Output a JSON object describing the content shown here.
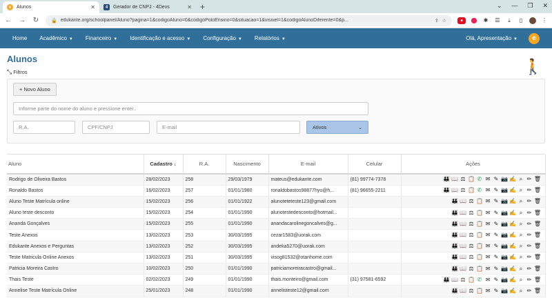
{
  "browser": {
    "tabs": [
      {
        "title": "Alunos",
        "favicon": "e",
        "active": true
      },
      {
        "title": "Gerador de CNPJ - 4Devs",
        "favicon": "4",
        "active": false
      }
    ],
    "url": "edukante.org/schoolpanel/Aluno?pagina=1&codigoAluno=0&codigoPoloEnsino=0&situacao=1&visivel=1&codigoAlunoDiferente=0&p..."
  },
  "nav": {
    "items": [
      {
        "label": "Home",
        "caret": false
      },
      {
        "label": "Acadêmico",
        "caret": true
      },
      {
        "label": "Financeiro",
        "caret": true
      },
      {
        "label": "Identificação e acesso",
        "caret": true
      },
      {
        "label": "Configuração",
        "caret": true
      },
      {
        "label": "Relatórios",
        "caret": true
      }
    ],
    "user": "Olá, Apresentação"
  },
  "page": {
    "title": "Alunos",
    "filters_label": "Filtros"
  },
  "filters": {
    "new_button": "+ Novo Aluno",
    "search_placeholder": "Informe parte do nome do aluno e pressione enter..",
    "ra_placeholder": "R.A.",
    "cpf_placeholder": "CPF/CNPJ",
    "email_placeholder": "E-mail",
    "status_selected": "Ativos"
  },
  "table": {
    "headers": [
      "Aluno",
      "Cadastro",
      "R.A.",
      "Nascimento",
      "E-mail",
      "Celular",
      "Ações"
    ],
    "rows": [
      {
        "aluno": "Rodrigo de Oliveira Bastos",
        "cadastro": "28/02/2023",
        "ra": "258",
        "nascimento": "29/03/1979",
        "email": "mateus@edukante.com",
        "celular": "(81) 99774-7378",
        "whatsapp": true
      },
      {
        "aluno": "Ronaldo Bastos",
        "cadastro": "16/02/2023",
        "ra": "257",
        "nascimento": "01/01/1980",
        "email": "ronaldobastos98877hyu@h...",
        "celular": "(81) 96655-2211",
        "whatsapp": true
      },
      {
        "aluno": "Aluno Teste Matrícula online",
        "cadastro": "15/02/2023",
        "ra": "256",
        "nascimento": "01/01/1922",
        "email": "alunoteteteste123@gmail.com",
        "celular": "",
        "whatsapp": false
      },
      {
        "aluno": "Aluno teste desconto",
        "cadastro": "15/02/2023",
        "ra": "254",
        "nascimento": "01/01/1990",
        "email": "alunotestedesconto@hotmail...",
        "celular": "",
        "whatsapp": false
      },
      {
        "aluno": "Ananda Gonçalves",
        "cadastro": "15/02/2023",
        "ra": "255",
        "nascimento": "01/01/1990",
        "email": "anandacarolinegoncalves@g...",
        "celular": "",
        "whatsapp": false
      },
      {
        "aluno": "Teste Anexos",
        "cadastro": "13/02/2023",
        "ra": "253",
        "nascimento": "30/03/1995",
        "email": "cezar1583@uorak.com",
        "celular": "",
        "whatsapp": false
      },
      {
        "aluno": "Edukante Anexos e Perguntas",
        "cadastro": "13/02/2023",
        "ra": "252",
        "nascimento": "30/03/1995",
        "email": "andeka5270@uorak.com",
        "celular": "",
        "whatsapp": false
      },
      {
        "aluno": "Teste Matricula Online Anexos",
        "cadastro": "13/02/2023",
        "ra": "251",
        "nascimento": "30/03/1995",
        "email": "visog81532@otanhome.com",
        "celular": "",
        "whatsapp": false
      },
      {
        "aluno": "Patricia Moreira Castro",
        "cadastro": "10/02/2023",
        "ra": "250",
        "nascimento": "01/01/1990",
        "email": "patriciamoreiracastro@gmail...",
        "celular": "",
        "whatsapp": false
      },
      {
        "aluno": "Thais Teste",
        "cadastro": "02/02/2023",
        "ra": "249",
        "nascimento": "01/01/1990",
        "email": "thais.monteiro@gmail.com",
        "celular": "(31) 97581-6592",
        "whatsapp": true
      },
      {
        "aluno": "Annelise Teste Matrícula Online",
        "cadastro": "25/01/2023",
        "ra": "248",
        "nascimento": "01/01/1990",
        "email": "annelisteste12@gmail.com",
        "celular": "",
        "whatsapp": false
      }
    ]
  },
  "colors": {
    "navbar": "#2f6f9a",
    "select": "#a9c6e8",
    "whatsapp": "#1da851"
  }
}
